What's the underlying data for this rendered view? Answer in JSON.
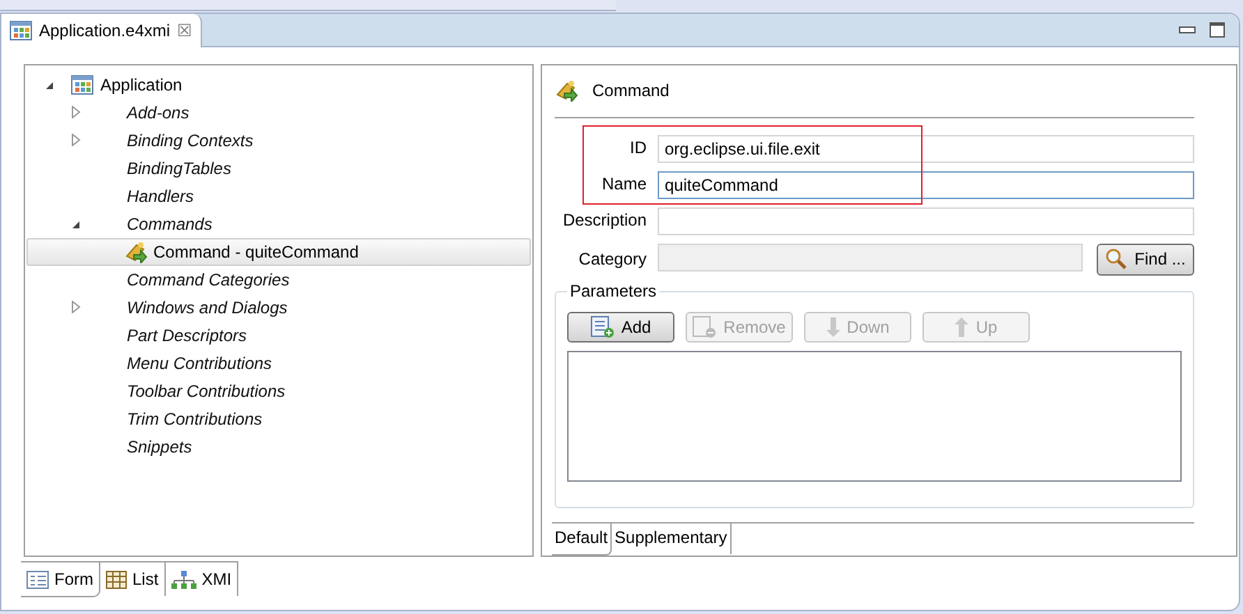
{
  "editor_tab": {
    "title": "Application.e4xmi",
    "close": "☒"
  },
  "tree": [
    {
      "label": "Application",
      "kind": "root",
      "expanded": true,
      "selected": false,
      "children": [
        {
          "label": "Add-ons",
          "kind": "category",
          "expanded": false,
          "selected": false
        },
        {
          "label": "Binding Contexts",
          "kind": "category",
          "expanded": false,
          "selected": false
        },
        {
          "label": "BindingTables",
          "kind": "category",
          "selected": false
        },
        {
          "label": "Handlers",
          "kind": "category",
          "selected": false
        },
        {
          "label": "Commands",
          "kind": "category",
          "expanded": true,
          "selected": false,
          "children": [
            {
              "label": "Command - quiteCommand",
              "kind": "command",
              "selected": true
            }
          ]
        },
        {
          "label": "Command Categories",
          "kind": "category",
          "selected": false
        },
        {
          "label": "Windows and Dialogs",
          "kind": "category",
          "expanded": false,
          "selected": false
        },
        {
          "label": "Part Descriptors",
          "kind": "category",
          "selected": false
        },
        {
          "label": "Menu Contributions",
          "kind": "category",
          "selected": false
        },
        {
          "label": "Toolbar Contributions",
          "kind": "category",
          "selected": false
        },
        {
          "label": "Trim Contributions",
          "kind": "category",
          "selected": false
        },
        {
          "label": "Snippets",
          "kind": "category",
          "selected": false
        }
      ]
    }
  ],
  "details": {
    "title": "Command",
    "fields": [
      {
        "label": "ID",
        "value": "org.eclipse.ui.file.exit",
        "disabled": false,
        "focused": false
      },
      {
        "label": "Name",
        "value": "quiteCommand",
        "disabled": false,
        "focused": true
      },
      {
        "label": "Description",
        "disabled": false,
        "focused": false
      },
      {
        "label": "Category",
        "disabled": true,
        "focused": false,
        "button": "Find ..."
      }
    ],
    "parameters": {
      "title": "Parameters",
      "buttons": [
        {
          "label": "Add",
          "kind": "add",
          "disabled": false
        },
        {
          "label": "Remove",
          "kind": "remove",
          "disabled": true
        },
        {
          "label": "Down",
          "kind": "down",
          "disabled": true
        },
        {
          "label": "Up",
          "kind": "up",
          "disabled": true
        }
      ]
    },
    "tabs": [
      {
        "label": "Default",
        "selected": true
      },
      {
        "label": "Supplementary",
        "selected": false
      }
    ]
  },
  "bottom_tabs": [
    {
      "label": "Form",
      "kind": "form",
      "selected": true
    },
    {
      "label": "List",
      "kind": "list",
      "selected": false
    },
    {
      "label": "XMI",
      "kind": "xmi",
      "selected": false
    }
  ]
}
